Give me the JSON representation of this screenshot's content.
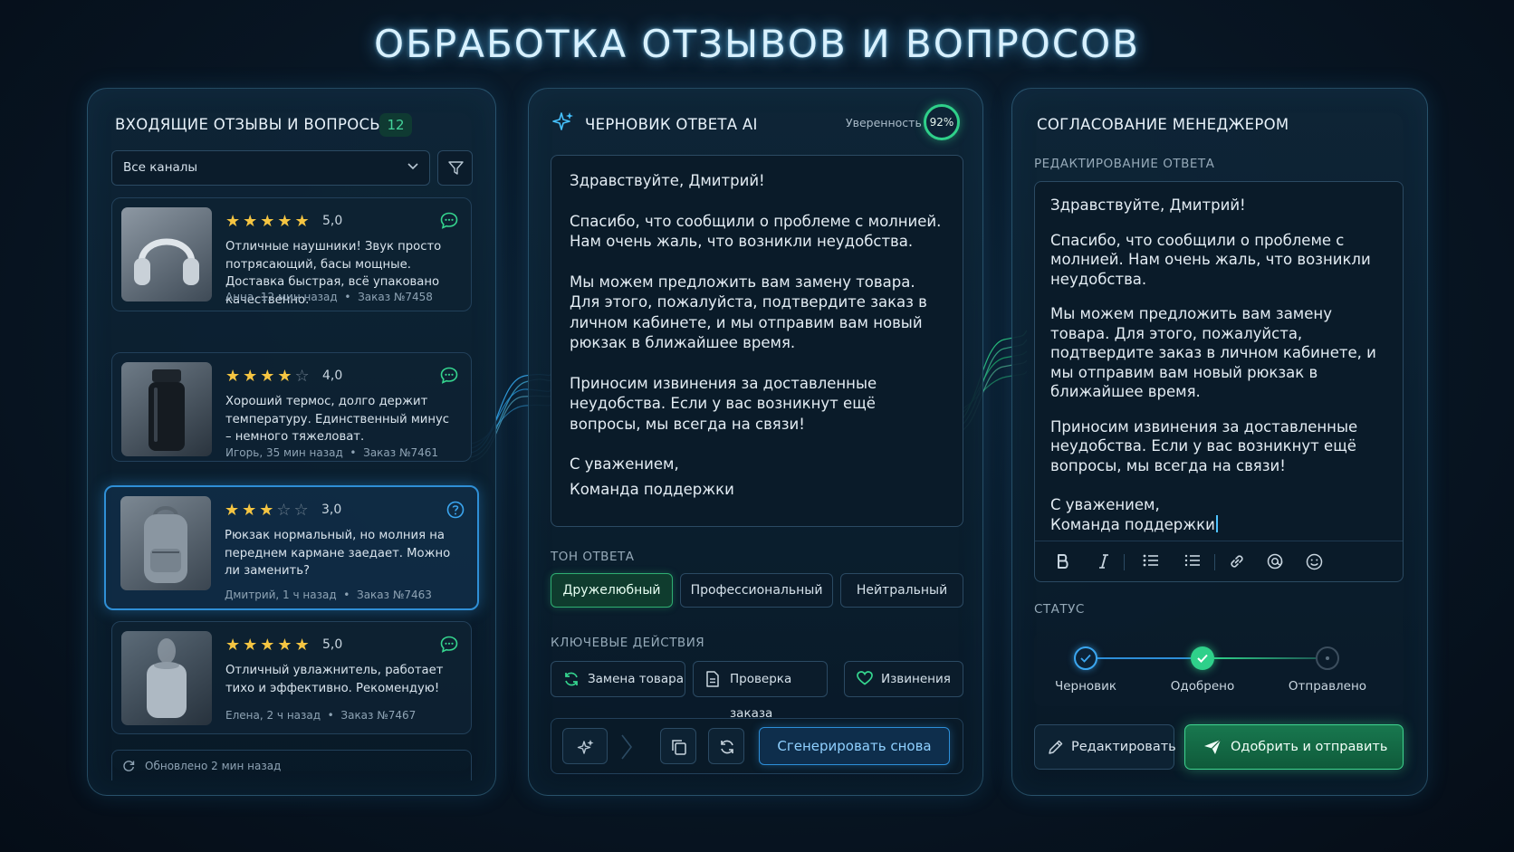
{
  "page_title": "ОБРАБОТКА ОТЗЫВОВ И ВОПРОСОВ",
  "inbox": {
    "title": "ВХОДЯЩИЕ ОТЗЫВЫ И ВОПРОСЫ",
    "count": "12",
    "channel_select": "Все каналы",
    "reviews": [
      {
        "rating": "5,0",
        "stars": 5,
        "text": "Отличные наушники! Звук просто потрясающий, басы мощные. Доставка быстрая, всё упаковано качественно.",
        "author": "Анна, 12 мин назад",
        "order": "Заказ №7458",
        "type_icon": "chat-icon",
        "product_icon": "headphones-icon"
      },
      {
        "rating": "4,0",
        "stars": 4,
        "text": "Хороший термос, долго держит температуру. Единственный минус – немного тяжеловат.",
        "author": "Игорь, 35 мин назад",
        "order": "Заказ №7461",
        "type_icon": "chat-icon",
        "product_icon": "thermos-icon"
      },
      {
        "rating": "3,0",
        "stars": 3,
        "text": "Рюкзак нормальный, но молния на переднем кармане заедает. Можно ли заменить?",
        "author": "Дмитрий, 1 ч назад",
        "order": "Заказ №7463",
        "type_icon": "question-icon",
        "product_icon": "backpack-icon"
      },
      {
        "rating": "5,0",
        "stars": 5,
        "text": "Отличный увлажнитель, работает тихо и эффективно. Рекомендую!",
        "author": "Елена, 2 ч назад",
        "order": "Заказ №7467",
        "type_icon": "chat-icon",
        "product_icon": "humidifier-icon"
      }
    ],
    "updated": "Обновлено 2 мин назад"
  },
  "draft": {
    "title": "ЧЕРНОВИК ОТВЕТА AI",
    "confidence_label": "Уверенность",
    "confidence": "92%",
    "greeting": "Здравствуйте, Дмитрий!",
    "para1": "Спасибо, что сообщили о проблеме с молнией. Нам очень жаль, что возникли неудобства.",
    "para2": "Мы можем предложить вам замену товара. Для этого, пожалуйста, подтвердите заказ в личном кабинете, и мы отправим вам новый рюкзак в ближайшее время.",
    "para3": "Приносим извинения за доставленные неудобства. Если у вас возникнут ещё вопросы, мы всегда на связи!",
    "sign1": "С уважением,",
    "sign2": "Команда поддержки",
    "tone_label": "ТОН ОТВЕТА",
    "tones": [
      "Дружелюбный",
      "Профессиональный",
      "Нейтральный"
    ],
    "actions_label": "КЛЮЧЕВЫЕ ДЕЙСТВИЯ",
    "actions": [
      "Замена товара",
      "Проверка заказа",
      "Извинения"
    ],
    "regenerate": "Сгенерировать снова"
  },
  "approval": {
    "title": "СОГЛАСОВАНИЕ МЕНЕДЖЕРОМ",
    "edit_label": "РЕДАКТИРОВАНИЕ ОТВЕТА",
    "greeting": "Здравствуйте, Дмитрий!",
    "para1": "Спасибо, что сообщили о проблеме с молнией. Нам очень жаль, что возникли неудобства.",
    "para2": "Мы можем предложить вам замену товара. Для этого, пожалуйста, подтвердите заказ в личном кабинете, и мы отправим вам новый рюкзак в ближайшее время.",
    "para3": "Приносим извинения за доставленные неудобства. Если у вас возникнут ещё вопросы, мы всегда на связи!",
    "sign1": "С уважением,",
    "sign2": "Команда поддержки",
    "status_label": "СТАТУС",
    "steps": [
      "Черновик",
      "Одобрено",
      "Отправлено"
    ],
    "edit_button": "Редактировать",
    "approve_button": "Одобрить и отправить"
  },
  "colors": {
    "accent_blue": "#2f8fd6",
    "accent_green": "#2fd08a",
    "star": "#f5c542"
  }
}
